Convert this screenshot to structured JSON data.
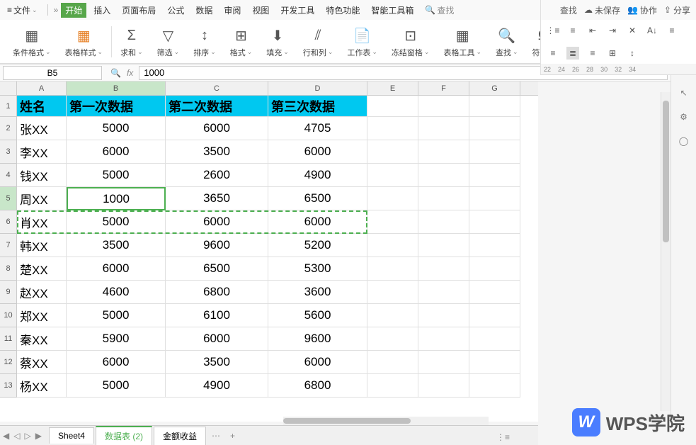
{
  "menu": {
    "file": "文件",
    "tabs": [
      "开始",
      "插入",
      "页面布局",
      "公式",
      "数据",
      "审阅",
      "视图",
      "开发工具",
      "特色功能",
      "智能工具箱"
    ],
    "search": "查找",
    "right_small": "查找"
  },
  "top_right": {
    "unsaved": "未保存",
    "collab": "协作",
    "share": "分享"
  },
  "toolbar": {
    "conditional_format": "条件格式",
    "table_style": "表格样式",
    "sum": "求和",
    "filter": "筛选",
    "sort": "排序",
    "format": "格式",
    "fill": "填充",
    "rowcol": "行和列",
    "worksheet": "工作表",
    "freeze": "冻结窗格",
    "table_tools": "表格工具",
    "find": "查找",
    "symbol": "符号"
  },
  "namebox": "B5",
  "formula_value": "1000",
  "columns": [
    "A",
    "B",
    "C",
    "D",
    "E",
    "F",
    "G"
  ],
  "headers": [
    "姓名",
    "第一次数据",
    "第二次数据",
    "第三次数据"
  ],
  "rows": [
    {
      "n": 1,
      "name": "",
      "d1": "",
      "d2": "",
      "d3": ""
    },
    {
      "n": 2,
      "name": "张XX",
      "d1": "5000",
      "d2": "6000",
      "d3": "4705"
    },
    {
      "n": 3,
      "name": "李XX",
      "d1": "6000",
      "d2": "3500",
      "d3": "6000"
    },
    {
      "n": 4,
      "name": "钱XX",
      "d1": "5000",
      "d2": "2600",
      "d3": "4900"
    },
    {
      "n": 5,
      "name": "周XX",
      "d1": "1000",
      "d2": "3650",
      "d3": "6500"
    },
    {
      "n": 6,
      "name": "肖XX",
      "d1": "5000",
      "d2": "6000",
      "d3": "6000"
    },
    {
      "n": 7,
      "name": "韩XX",
      "d1": "3500",
      "d2": "9600",
      "d3": "5200"
    },
    {
      "n": 8,
      "name": "楚XX",
      "d1": "6000",
      "d2": "6500",
      "d3": "5300"
    },
    {
      "n": 9,
      "name": "赵XX",
      "d1": "4600",
      "d2": "6800",
      "d3": "3600"
    },
    {
      "n": 10,
      "name": "郑XX",
      "d1": "5000",
      "d2": "6100",
      "d3": "5600"
    },
    {
      "n": 11,
      "name": "秦XX",
      "d1": "5900",
      "d2": "6000",
      "d3": "9600"
    },
    {
      "n": 12,
      "name": "蔡XX",
      "d1": "6000",
      "d2": "3500",
      "d3": "6000"
    },
    {
      "n": 13,
      "name": "杨XX",
      "d1": "5000",
      "d2": "4900",
      "d3": "6800"
    }
  ],
  "tabs": {
    "sheet4": "Sheet4",
    "data_sheet": "数据表 (2)",
    "profit": "金额收益"
  },
  "ruler": [
    "22",
    "24",
    "26",
    "28",
    "30",
    "32",
    "34"
  ],
  "watermark": "WPS学院"
}
